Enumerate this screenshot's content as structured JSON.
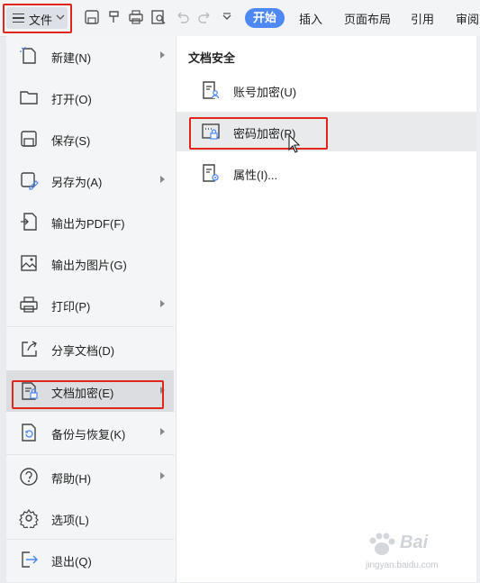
{
  "toolbar": {
    "file_label": "文件",
    "tabs": [
      {
        "label": "开始",
        "active": true
      },
      {
        "label": "插入"
      },
      {
        "label": "页面布局"
      },
      {
        "label": "引用"
      },
      {
        "label": "审阅"
      }
    ],
    "icons": [
      "save-icon",
      "format-painter-icon",
      "print-icon",
      "print-preview-icon",
      "undo-icon",
      "redo-icon",
      "more-dropdown-icon"
    ]
  },
  "menu": {
    "items": [
      {
        "label": "新建(N)",
        "icon": "new-file-icon",
        "has_submenu": true
      },
      {
        "label": "打开(O)",
        "icon": "folder-icon",
        "has_submenu": false
      },
      {
        "label": "保存(S)",
        "icon": "save-icon",
        "has_submenu": false
      },
      {
        "label": "另存为(A)",
        "icon": "save-as-icon",
        "has_submenu": true
      },
      {
        "label": "输出为PDF(F)",
        "icon": "export-pdf-icon",
        "has_submenu": false
      },
      {
        "label": "输出为图片(G)",
        "icon": "export-image-icon",
        "has_submenu": false
      },
      {
        "label": "打印(P)",
        "icon": "print-icon",
        "has_submenu": true
      },
      {
        "label": "分享文档(D)",
        "icon": "share-icon",
        "has_submenu": false
      },
      {
        "label": "文档加密(E)",
        "icon": "document-encrypt-icon",
        "has_submenu": true,
        "active": true
      },
      {
        "label": "备份与恢复(K)",
        "icon": "backup-icon",
        "has_submenu": true
      },
      {
        "label": "帮助(H)",
        "icon": "help-icon",
        "has_submenu": true
      },
      {
        "label": "选项(L)",
        "icon": "gear-icon",
        "has_submenu": false
      },
      {
        "label": "退出(Q)",
        "icon": "exit-icon",
        "has_submenu": false
      }
    ]
  },
  "submenu": {
    "heading": "文档安全",
    "items": [
      {
        "label": "账号加密(U)",
        "icon": "account-encrypt-icon"
      },
      {
        "label": "密码加密(P)",
        "icon": "password-encrypt-icon",
        "highlighted": true
      },
      {
        "label": "属性(I)...",
        "icon": "properties-icon"
      }
    ]
  },
  "watermark": {
    "text": "Bai",
    "sub": "jingyan.baidu.com"
  },
  "colors": {
    "accent": "#4e88f4",
    "highlight_box": "#e0261b",
    "menu_bg": "#f4f5f7"
  }
}
